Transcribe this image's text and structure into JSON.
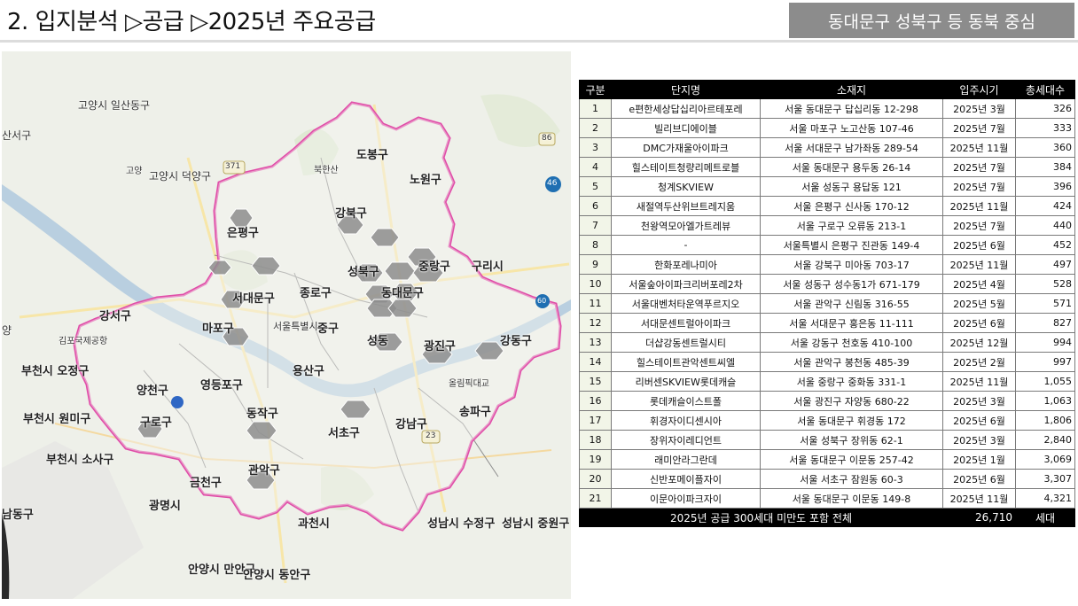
{
  "header": {
    "title": "2. 입지분석 ▷공급 ▷2025년 주요공급",
    "badge": "동대문구 성북구 등 동북 중심"
  },
  "map": {
    "labels": {
      "goyang_ilsan": "고양시 일산동구",
      "goyang_deokyang": "고양시 덕양구",
      "goyang_small": "고양",
      "seoseo": "산서구",
      "dobong": "도봉구",
      "nowon": "노원구",
      "gangbuk": "강북구",
      "eunpyeong": "은평구",
      "seongbuk": "성북구",
      "jungnang": "중랑구",
      "guri": "구리시",
      "seodaemun": "서대문구",
      "jongno": "종로구",
      "dongdaemun": "동대문구",
      "gangseo": "강서구",
      "mapo": "마포구",
      "jung": "중구",
      "seongdong": "성동",
      "gwangjin": "광진구",
      "gangdong": "강동구",
      "yongsan": "용산구",
      "yangcheon": "양천구",
      "yeongdeungpo": "영등포구",
      "bucheon_ojeong": "부천시 오정구",
      "bucheon_wonmi": "부천시 원미구",
      "bucheon_sosa": "부천시 소사구",
      "guro": "구로구",
      "dongjak": "동작구",
      "seocho": "서초구",
      "gangnam": "강남구",
      "songpa": "송파구",
      "geumcheon": "금천구",
      "gwanak": "관악구",
      "gwangmyeong": "광명시",
      "gwacheon": "과천시",
      "seongnam_sujeong": "성남시 수정구",
      "seongnam_jungwon": "성남시 중원구",
      "namdong": "남동구",
      "anyang_manan": "안양시 만안구",
      "anyang_dongan": "안양시 동안구",
      "gimpo_airport": "김포국제공항",
      "olympic_bridge": "올림픽대교",
      "bukhansan": "북한산",
      "seoul_station": "서울특별시",
      "road_371": "371",
      "road_86": "86",
      "road_46": "46",
      "road_23": "23",
      "road_60": "60",
      "yang": "양"
    },
    "markers": [
      "1",
      "2",
      "3",
      "4",
      "5",
      "6",
      "7",
      "8",
      "9",
      "10",
      "11",
      "12",
      "13",
      "14",
      "15",
      "16",
      "17",
      "18",
      "19",
      "20",
      "21"
    ],
    "colors": {
      "boundary": "#e04da8",
      "marker": "#8a8a8a"
    }
  },
  "table": {
    "headers": [
      "구분",
      "단지명",
      "소재지",
      "입주시기",
      "총세대수"
    ],
    "rows": [
      [
        "1",
        "e편한세상답십리아르테포레",
        "서울 동대문구 답십리동 12-298",
        "2025년 3월",
        "326"
      ],
      [
        "2",
        "빌리브디에이블",
        "서울 마포구 노고산동 107-46",
        "2025년 7월",
        "333"
      ],
      [
        "3",
        "DMC가재울아이파크",
        "서울 서대문구 남가좌동 289-54",
        "2025년 11월",
        "360"
      ],
      [
        "4",
        "힐스테이트청량리메트로블",
        "서울 동대문구 용두동 26-14",
        "2025년 7월",
        "384"
      ],
      [
        "5",
        "청계SKVIEW",
        "서울 성동구 용답동 121",
        "2025년 7월",
        "396"
      ],
      [
        "6",
        "새절역두산위브트레지움",
        "서울 은평구 신사동 170-12",
        "2025년 11월",
        "424"
      ],
      [
        "7",
        "천왕역모아엘가트레뷰",
        "서울 구로구 오류동 213-1",
        "2025년 7월",
        "440"
      ],
      [
        "8",
        "-",
        "서울특별시 은평구 진관동 149-4",
        "2025년 6월",
        "452"
      ],
      [
        "9",
        "한화포레나미아",
        "서울 강북구 미아동 703-17",
        "2025년 11월",
        "497"
      ],
      [
        "10",
        "서울숲아이파크리버포레2차",
        "서울 성동구 성수동1가 671-179",
        "2025년 4월",
        "528"
      ],
      [
        "11",
        "서울대벤처타운역푸르지오",
        "서울 관악구 신림동 316-55",
        "2025년 5월",
        "571"
      ],
      [
        "12",
        "서대문센트럴아이파크",
        "서울 서대문구 홍은동 11-111",
        "2025년 6월",
        "827"
      ],
      [
        "13",
        "더샵강동센트럴시티",
        "서울 강동구 천호동 410-100",
        "2025년 12월",
        "994"
      ],
      [
        "14",
        "힐스테이트관악센트씨엘",
        "서울 관악구 봉천동 485-39",
        "2025년 2월",
        "997"
      ],
      [
        "15",
        "리버센SKVIEW롯데캐슬",
        "서울 중랑구 중화동 331-1",
        "2025년 11월",
        "1,055"
      ],
      [
        "16",
        "롯데캐슬이스트폴",
        "서울 광진구 자양동 680-22",
        "2025년 3월",
        "1,063"
      ],
      [
        "17",
        "휘경자이디센시아",
        "서울 동대문구 휘경동 172",
        "2025년 6월",
        "1,806"
      ],
      [
        "18",
        "장위자이레디언트",
        "서울 성북구 장위동 62-1",
        "2025년 3월",
        "2,840"
      ],
      [
        "19",
        "래미안라그란데",
        "서울 동대문구 이문동 257-42",
        "2025년 1월",
        "3,069"
      ],
      [
        "20",
        "신반포메이플자이",
        "서울 서초구 잠원동 60-3",
        "2025년 6월",
        "3,307"
      ],
      [
        "21",
        "이문아이파크자이",
        "서울 동대문구 이문동 149-8",
        "2025년 11월",
        "4,321"
      ]
    ],
    "footer": {
      "label": "2025년 공급 300세대 미만도 포함 전체",
      "total": "26,710",
      "unit": "세대"
    }
  }
}
